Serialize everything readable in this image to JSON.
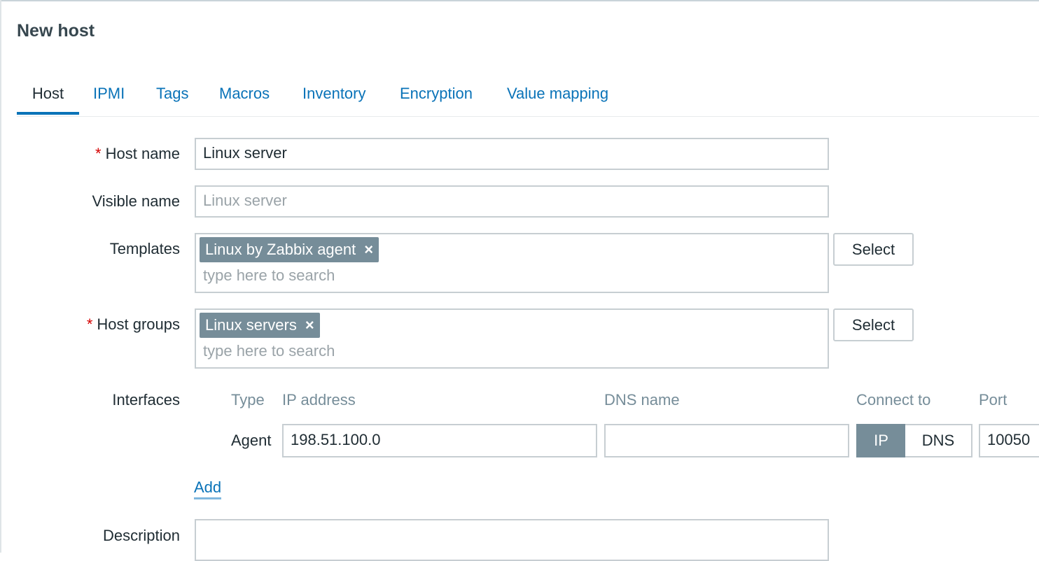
{
  "page": {
    "title": "New host"
  },
  "tabs": [
    {
      "label": "Host",
      "active": true
    },
    {
      "label": "IPMI"
    },
    {
      "label": "Tags"
    },
    {
      "label": "Macros"
    },
    {
      "label": "Inventory"
    },
    {
      "label": "Encryption"
    },
    {
      "label": "Value mapping"
    }
  ],
  "form": {
    "host_name": {
      "label": "Host name",
      "required_mark": "*",
      "value": "Linux server"
    },
    "visible_name": {
      "label": "Visible name",
      "placeholder": "Linux server"
    },
    "templates": {
      "label": "Templates",
      "selected": "Linux by Zabbix agent",
      "remove_icon": "×",
      "search_placeholder": "type here to search",
      "select_button": "Select"
    },
    "host_groups": {
      "label": "Host groups",
      "required_mark": "*",
      "selected": "Linux servers",
      "remove_icon": "×",
      "search_placeholder": "type here to search",
      "select_button": "Select"
    },
    "interfaces": {
      "label": "Interfaces",
      "columns": {
        "type": "Type",
        "ip_address": "IP address",
        "dns_name": "DNS name",
        "connect_to": "Connect to",
        "port": "Port"
      },
      "row": {
        "type": "Agent",
        "ip_address": "198.51.100.0",
        "dns_name": "",
        "connect_ip": "IP",
        "connect_dns": "DNS",
        "connect_selected": "IP",
        "port": "10050"
      },
      "add_link": "Add"
    },
    "description": {
      "label": "Description",
      "value": ""
    }
  },
  "colors": {
    "link": "#0a73b8",
    "chip_bg": "#768d99",
    "required": "#d50000",
    "border": "#c7ced2"
  }
}
